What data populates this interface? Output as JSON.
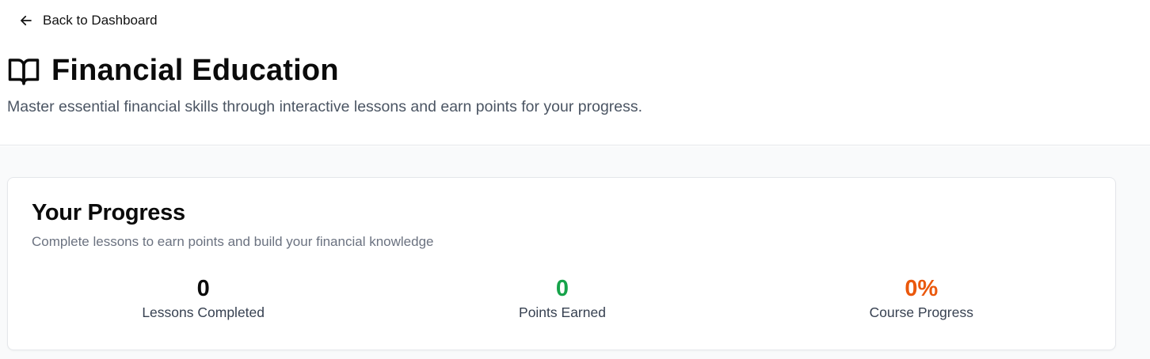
{
  "header": {
    "back_label": "Back to Dashboard",
    "back_icon": "arrow-left-icon",
    "title_icon": "book-open-icon",
    "title": "Financial Education",
    "subtitle": "Master essential financial skills through interactive lessons and earn points for your progress."
  },
  "progress": {
    "title": "Your Progress",
    "subtitle": "Complete lessons to earn points and build your financial knowledge",
    "stats": [
      {
        "value": "0",
        "label": "Lessons Completed",
        "color": "#0b0b0b"
      },
      {
        "value": "0",
        "label": "Points Earned",
        "color": "#16a34a"
      },
      {
        "value": "0%",
        "label": "Course Progress",
        "color": "#ea580c"
      }
    ]
  }
}
